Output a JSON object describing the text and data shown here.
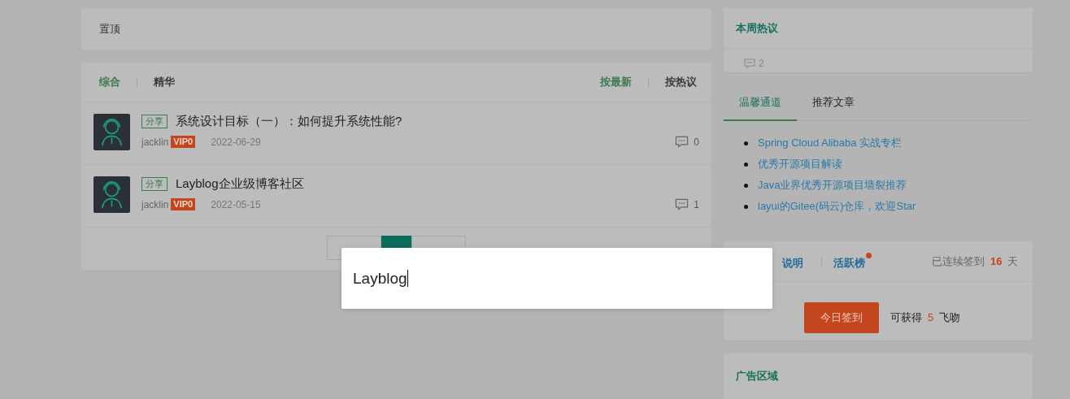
{
  "pinned_card": {
    "title": "置顶"
  },
  "list_card": {
    "filters": [
      {
        "label": "综合",
        "selected": true
      },
      {
        "label": "精华",
        "selected": false
      }
    ],
    "sorts": [
      {
        "label": "按最新",
        "selected": true
      },
      {
        "label": "按热议",
        "selected": false
      }
    ],
    "posts": [
      {
        "tag": "分享",
        "title": "系统设计目标（一）：如何提升系统性能?",
        "author": "jacklin",
        "badge": "VIP0",
        "date": "2022-06-29",
        "comments": "0"
      },
      {
        "tag": "分享",
        "title": "Layblog企业级博客社区",
        "author": "jacklin",
        "badge": "VIP0",
        "date": "2022-05-15",
        "comments": "1"
      }
    ],
    "pagination": [
      {
        "selected": false
      },
      {
        "selected": true
      },
      {
        "selected": false
      }
    ]
  },
  "hot_card": {
    "title": "本周热议",
    "items": [
      {
        "comments": "2"
      }
    ]
  },
  "tabs": [
    {
      "label": "温馨通道",
      "selected": true
    },
    {
      "label": "推荐文章",
      "selected": false
    }
  ],
  "links": [
    "Spring Cloud Alibaba 实战专栏",
    "优秀开源项目解读",
    "Java业界优秀开源项目墙裂推荐",
    "layui的Gitee(码云)仓库，欢迎Star"
  ],
  "signin": {
    "links": [
      {
        "label": "说明",
        "dot": false
      },
      {
        "label": "活跃榜",
        "dot": true
      }
    ],
    "streak_prefix": "已连续签到",
    "streak_days": "16",
    "streak_suffix": "天",
    "button": "今日签到",
    "reward_prefix": "可获得",
    "reward_amount": "5",
    "reward_suffix": "飞吻"
  },
  "ad_card": {
    "title": "广告区域"
  },
  "search": {
    "value": "Layblog"
  }
}
